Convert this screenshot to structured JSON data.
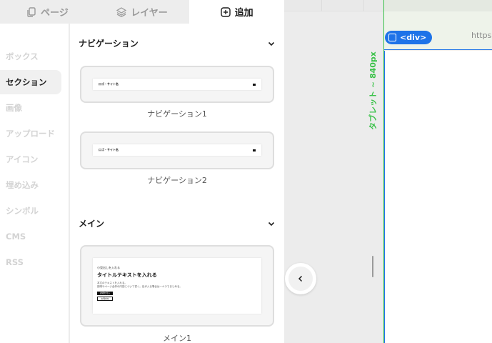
{
  "tabs": [
    {
      "label": "ページ",
      "icon": "pages-icon",
      "active": false
    },
    {
      "label": "レイヤー",
      "icon": "layers-icon",
      "active": false
    },
    {
      "label": "追加",
      "icon": "plus-square-icon",
      "active": true
    }
  ],
  "categories": [
    {
      "label": "ボックス",
      "active": false
    },
    {
      "label": "セクション",
      "active": true
    },
    {
      "label": "画像",
      "active": false
    },
    {
      "label": "アップロード",
      "active": false
    },
    {
      "label": "アイコン",
      "active": false
    },
    {
      "label": "埋め込み",
      "active": false
    },
    {
      "label": "シンボル",
      "active": false
    },
    {
      "label": "CMS",
      "active": false
    },
    {
      "label": "RSS",
      "active": false
    }
  ],
  "sections": {
    "navigation": {
      "title": "ナビゲーション",
      "items": [
        {
          "label": "ナビゲーション1",
          "logo_text": "ロゴ・サイト名"
        },
        {
          "label": "ナビゲーション2",
          "logo_text": "ロゴ・サイト名"
        }
      ]
    },
    "main": {
      "title": "メイン",
      "items": [
        {
          "label": "メイン1",
          "small_heading": "小見出しを入れる",
          "title": "タイトルテキストを入れる",
          "body_line1": "本文のテキストを入れる。",
          "body_line2": "説明やページ全体の内容について書く。目が入る場合は一ペラでまとめる。",
          "button_primary": "詳細を見る",
          "button_secondary": "お問合せ"
        }
      ]
    }
  },
  "canvas": {
    "breakpoint_label": "タブレット ~ 840px",
    "element_badge": "<div>",
    "url_text": "https"
  },
  "colors": {
    "accent_green": "#3bc24a",
    "accent_blue": "#1e73e8"
  }
}
